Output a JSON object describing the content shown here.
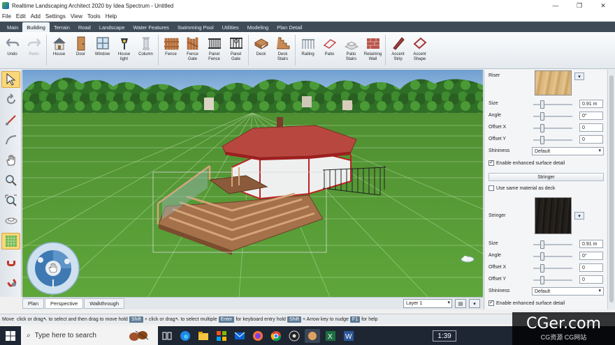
{
  "window": {
    "title": "Realtime Landscaping Architect 2020 by Idea Spectrum - Untitled",
    "controls": [
      "—",
      "❐",
      "✕"
    ]
  },
  "menu": [
    "File",
    "Edit",
    "Add",
    "Settings",
    "View",
    "Tools",
    "Help"
  ],
  "tabs": [
    {
      "label": "Main"
    },
    {
      "label": "Building",
      "active": true
    },
    {
      "label": "Terrain"
    },
    {
      "label": "Road"
    },
    {
      "label": "Landscape"
    },
    {
      "label": "Water Features"
    },
    {
      "label": "Swimming Pool"
    },
    {
      "label": "Utilities"
    },
    {
      "label": "Modeling"
    },
    {
      "label": "Plan Detail"
    }
  ],
  "ribbon": [
    {
      "label": "Undo",
      "icon": "undo-icon"
    },
    {
      "label": "Redo",
      "icon": "redo-icon",
      "disabled": true
    },
    {
      "label": "House",
      "icon": "house-icon"
    },
    {
      "label": "Door",
      "icon": "door-icon"
    },
    {
      "label": "Window",
      "icon": "window-icon"
    },
    {
      "label": "House\nlight",
      "icon": "house-light-icon"
    },
    {
      "label": "Column",
      "icon": "column-icon"
    },
    {
      "label": "Fence",
      "icon": "fence-icon"
    },
    {
      "label": "Fence\nGate",
      "icon": "fence-gate-icon"
    },
    {
      "label": "Panel\nFence",
      "icon": "panel-fence-icon"
    },
    {
      "label": "Panel\nGate",
      "icon": "panel-gate-icon"
    },
    {
      "label": "Deck",
      "icon": "deck-icon"
    },
    {
      "label": "Deck\nStairs",
      "icon": "deck-stairs-icon"
    },
    {
      "label": "Railing",
      "icon": "railing-icon"
    },
    {
      "label": "Patio",
      "icon": "patio-icon"
    },
    {
      "label": "Patio\nStairs",
      "icon": "patio-stairs-icon"
    },
    {
      "label": "Retaining\nWall",
      "icon": "retaining-wall-icon"
    },
    {
      "label": "Accent\nStrip",
      "icon": "accent-strip-icon"
    },
    {
      "label": "Accent\nShape",
      "icon": "accent-shape-icon"
    }
  ],
  "left_tools": [
    "select-arrow-icon",
    "rotate-icon",
    "measure-icon",
    "arc-icon",
    "hand-pan-icon",
    "zoom-icon",
    "zoom-extents-icon",
    "orbit-icon",
    "grid-toggle-icon",
    "magnet-icon",
    "magnet-settings-icon"
  ],
  "view_tabs": [
    {
      "label": "Plan"
    },
    {
      "label": "Perspective",
      "active": true
    },
    {
      "label": "Walkthrough"
    }
  ],
  "layer": {
    "value": "Layer 1"
  },
  "panel": {
    "riser_label": "Riser",
    "size_label": "Size",
    "size_value": "0.91 m",
    "angle_label": "Angle",
    "angle_value": "0°",
    "offset_x_label": "Offset X",
    "offset_x_value": "0",
    "offset_y_label": "Offset Y",
    "offset_y_value": "0",
    "shininess_label": "Shininess",
    "shininess_value": "Default",
    "enhanced_label": "Enable enhanced surface detail",
    "stringer_header": "Stringer",
    "same_material_label": "Use same material as deck",
    "stringer_label": "Stringer",
    "s_size_label": "Size",
    "s_size_value": "0.91 m",
    "s_angle_label": "Angle",
    "s_angle_value": "0°",
    "s_offset_x_label": "Offset X",
    "s_offset_x_value": "0",
    "s_offset_y_label": "Offset Y",
    "s_offset_y_value": "0",
    "s_shininess_label": "Shininess",
    "s_shininess_value": "Default",
    "s_enhanced_label": "Enable enhanced surface detail"
  },
  "status": {
    "t1": "Move",
    "t2": "click or drag",
    "t3": "to select and then drag to move",
    "t4": "hold",
    "k1": "Shift",
    "t5": "+ click or drag",
    "t6": "to select multiple",
    "k2": "Enter",
    "t7": "for keyboard entry",
    "t8": "hold",
    "k3": "Shift",
    "t9": "+ Arrow key to nudge",
    "k4": "F1",
    "t10": "for help"
  },
  "taskbar": {
    "search_placeholder": "Type here to search",
    "time": "1:39",
    "apps": [
      "task-view-icon",
      "edge-icon",
      "file-explorer-icon",
      "store-icon",
      "mail-icon",
      "firefox-icon",
      "chrome-icon",
      "obs-icon",
      "landscaping-app-icon",
      "excel-icon",
      "word-icon"
    ]
  },
  "watermark": {
    "big": "CGer.com",
    "small": "CG资源 CG网站"
  }
}
